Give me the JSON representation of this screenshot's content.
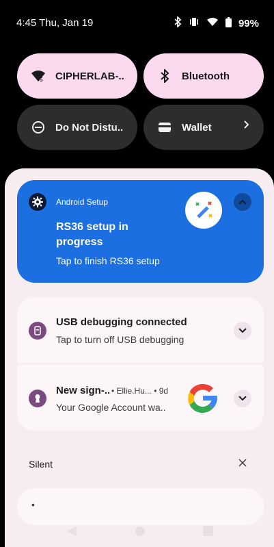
{
  "status": {
    "time": "4:45 Thu, Jan 19",
    "battery": "99%"
  },
  "quick_settings": {
    "wifi_label": "CIPHERLAB-..",
    "bluetooth_label": "Bluetooth",
    "dnd_label": "Do Not Distu..",
    "wallet_label": "Wallet"
  },
  "notifications": {
    "setup": {
      "app": "Android Setup",
      "title": "RS36 setup in progress",
      "text": "Tap to finish RS36 setup"
    },
    "usb": {
      "title": "USB debugging connected",
      "text": "Tap to turn off USB debugging"
    },
    "google": {
      "title": "New sign-..",
      "meta": "• Ellie.Hu... • 9d",
      "text": "Your Google Account wa.."
    },
    "silent_header": "Silent",
    "silent_item": "•"
  },
  "colors": {
    "setup_card": "#1b6fe0",
    "shade": "#f7ecef",
    "tile_on": "#fbd9ef",
    "tile_off": "#2f2c2e"
  },
  "icons": [
    "wifi-icon",
    "bluetooth-icon",
    "vibrate-icon",
    "battery-icon",
    "dnd-icon",
    "wallet-icon",
    "gear-icon",
    "magic-wand-icon",
    "usb-icon",
    "keyhole-icon",
    "google-icon",
    "chevron-down-icon",
    "chevron-up-icon",
    "close-icon"
  ]
}
